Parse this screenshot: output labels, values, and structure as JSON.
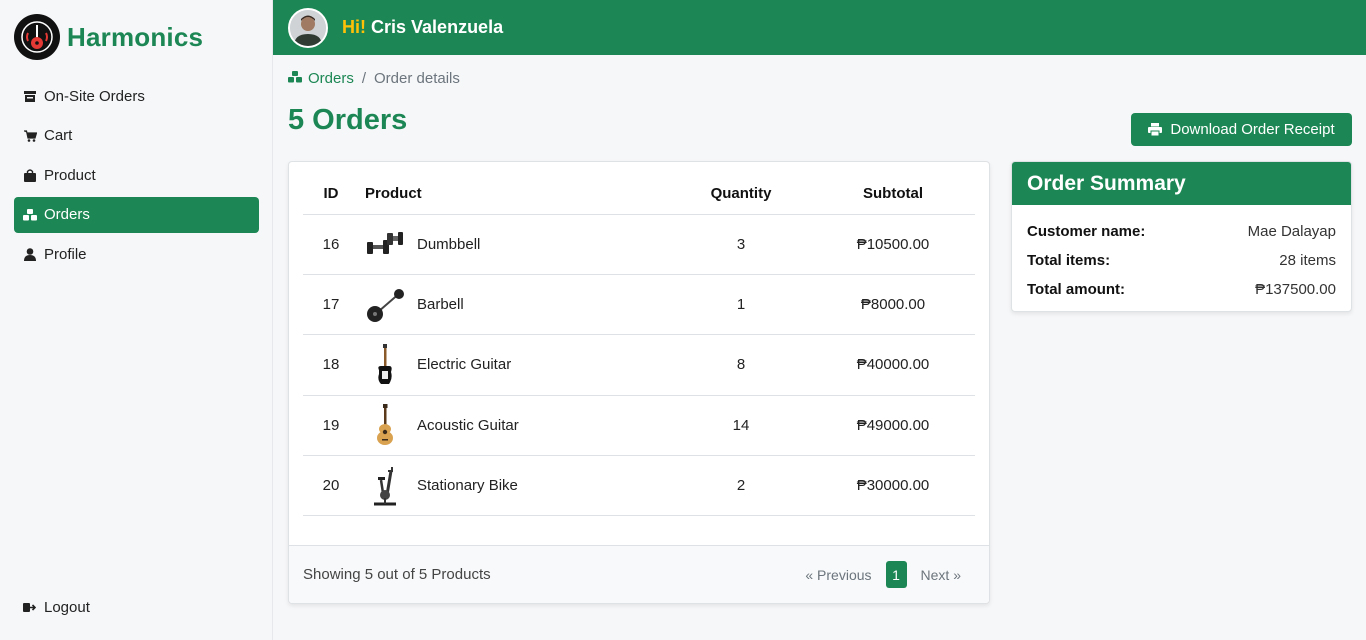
{
  "brand": {
    "name": "Harmonics",
    "logo_icon": "guitar-logo-icon"
  },
  "sidebar": {
    "items": [
      {
        "label": "On-Site Orders",
        "icon": "store-icon",
        "active": false
      },
      {
        "label": "Cart",
        "icon": "cart-icon",
        "active": false
      },
      {
        "label": "Product",
        "icon": "bag-icon",
        "active": false
      },
      {
        "label": "Orders",
        "icon": "boxes-icon",
        "active": true
      },
      {
        "label": "Profile",
        "icon": "user-icon",
        "active": false
      }
    ],
    "logout_label": "Logout"
  },
  "topbar": {
    "hi": "Hi!",
    "user_name": "Cris Valenzuela"
  },
  "breadcrumb": {
    "link": "Orders",
    "separator": "/",
    "current": "Order details"
  },
  "page": {
    "title": "5 Orders",
    "download_label": "Download Order Receipt"
  },
  "table": {
    "headers": {
      "id": "ID",
      "product": "Product",
      "quantity": "Quantity",
      "subtotal": "Subtotal"
    },
    "rows": [
      {
        "id": "16",
        "product": "Dumbbell",
        "quantity": "3",
        "subtotal": "₱10500.00",
        "thumb": "dumbbell-image"
      },
      {
        "id": "17",
        "product": "Barbell",
        "quantity": "1",
        "subtotal": "₱8000.00",
        "thumb": "barbell-image"
      },
      {
        "id": "18",
        "product": "Electric Guitar",
        "quantity": "8",
        "subtotal": "₱40000.00",
        "thumb": "electric-guitar-image"
      },
      {
        "id": "19",
        "product": "Acoustic Guitar",
        "quantity": "14",
        "subtotal": "₱49000.00",
        "thumb": "acoustic-guitar-image"
      },
      {
        "id": "20",
        "product": "Stationary Bike",
        "quantity": "2",
        "subtotal": "₱30000.00",
        "thumb": "stationary-bike-image"
      }
    ]
  },
  "footer": {
    "showing": "Showing 5 out of 5 Products",
    "prev": "« Previous",
    "page": "1",
    "next": "Next »"
  },
  "summary": {
    "title": "Order Summary",
    "customer_label": "Customer name:",
    "customer_value": "Mae Dalayap",
    "items_label": "Total items:",
    "items_value": "28 items",
    "amount_label": "Total amount:",
    "amount_value": "₱137500.00"
  },
  "colors": {
    "accent": "#1c8754",
    "greeting_hi": "#ffc107",
    "background": "#f6f7f9"
  }
}
